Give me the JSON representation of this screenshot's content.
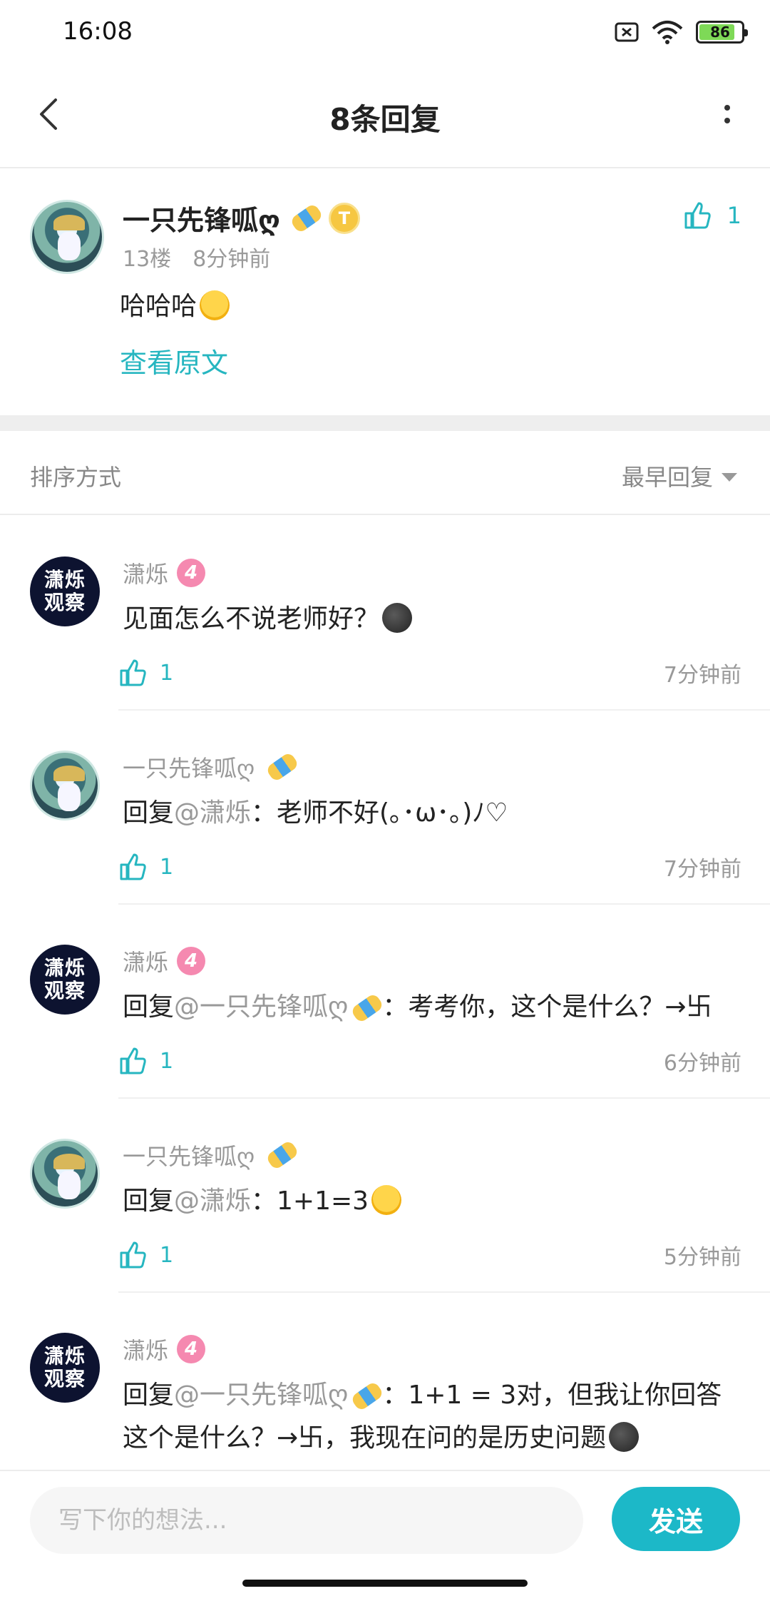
{
  "status": {
    "time": "16:08",
    "battery": "86",
    "battery_level": 0.86
  },
  "header": {
    "title": "8条回复"
  },
  "main_comment": {
    "author": "一只先锋呱ღ",
    "floor": "13楼",
    "time": "8分钟前",
    "text": "哈哈哈",
    "view_original": "查看原文",
    "likes": "1",
    "badge": "T"
  },
  "sort": {
    "label": "排序方式",
    "selected": "最早回复"
  },
  "replies": [
    {
      "author": "潇烁",
      "level": "4",
      "prefix": "",
      "mention": "",
      "text": "见面怎么不说老师好？",
      "likes": "1",
      "time": "7分钟前"
    },
    {
      "author": "一只先锋呱ღ",
      "level": "",
      "prefix": "回复",
      "mention": "@潇烁",
      "text": "：老师不好(｡･ω･｡)ﾉ♡",
      "likes": "1",
      "time": "7分钟前"
    },
    {
      "author": "潇烁",
      "level": "4",
      "prefix": "回复",
      "mention": "@一只先锋呱ღ",
      "text": "：考考你，这个是什么？→卐",
      "likes": "1",
      "time": "6分钟前"
    },
    {
      "author": "一只先锋呱ღ",
      "level": "",
      "prefix": "回复",
      "mention": "@潇烁",
      "text": "：1+1=3",
      "likes": "1",
      "time": "5分钟前"
    },
    {
      "author": "潇烁",
      "level": "4",
      "prefix": "回复",
      "mention": "@一只先锋呱ღ",
      "text": "：1+1 = 3对，但我让你回答这个是什么？→卐，我现在问的是历史问题",
      "likes": "",
      "time": ""
    }
  ],
  "avatar_text": {
    "line1": "潇烁",
    "line2": "观察"
  },
  "input": {
    "placeholder": "写下你的想法...",
    "send_label": "发送"
  },
  "colors": {
    "accent": "#1cb8c8",
    "link": "#26b6c0",
    "level_badge": "#f589b0"
  }
}
